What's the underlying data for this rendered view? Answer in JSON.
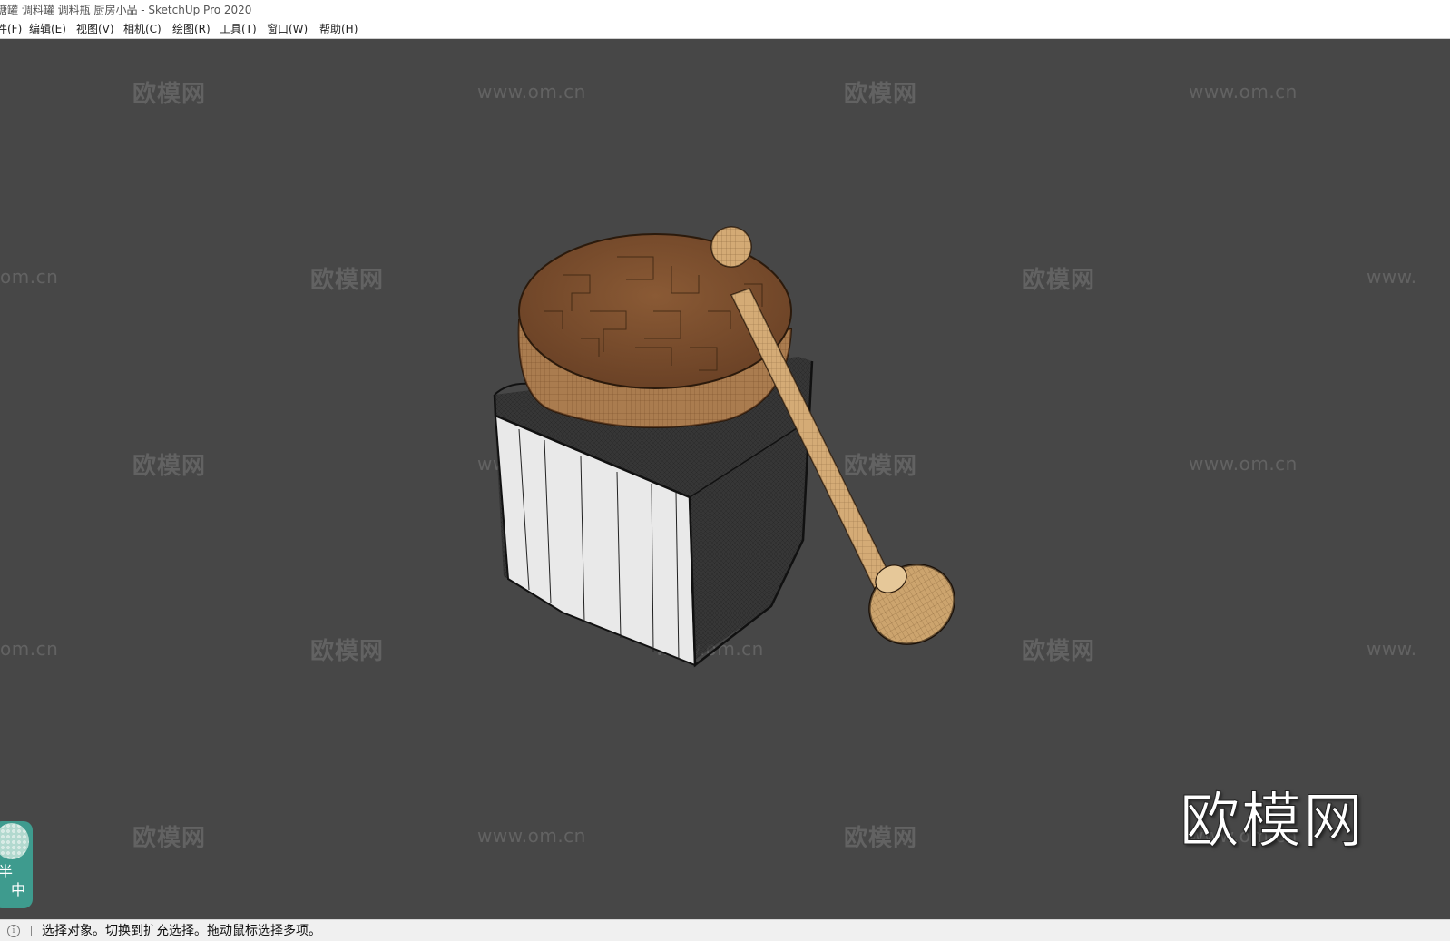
{
  "window": {
    "title": "糖罐 调料罐 调料瓶 厨房小品 - SketchUp Pro 2020"
  },
  "menubar": {
    "items": [
      {
        "label": "件(F)"
      },
      {
        "label": "编辑(E)"
      },
      {
        "label": "视图(V)"
      },
      {
        "label": "相机(C)"
      },
      {
        "label": "绘图(R)"
      },
      {
        "label": "工具(T)"
      },
      {
        "label": "窗口(W)"
      },
      {
        "label": "帮助(H)"
      }
    ]
  },
  "viewport": {
    "background_color": "#474747",
    "model": "honey-jar-with-dipper",
    "watermark_cn": "欧模网",
    "watermark_url": "www.om.cn",
    "watermark_url_left": "om.cn",
    "watermark_url_right": "www.",
    "big_logo": "欧模网",
    "badge_chars": [
      "半",
      "中"
    ]
  },
  "statusbar": {
    "info_icon": "info-icon",
    "text": "选择对象。切换到扩充选择。拖动鼠标选择多项。"
  }
}
